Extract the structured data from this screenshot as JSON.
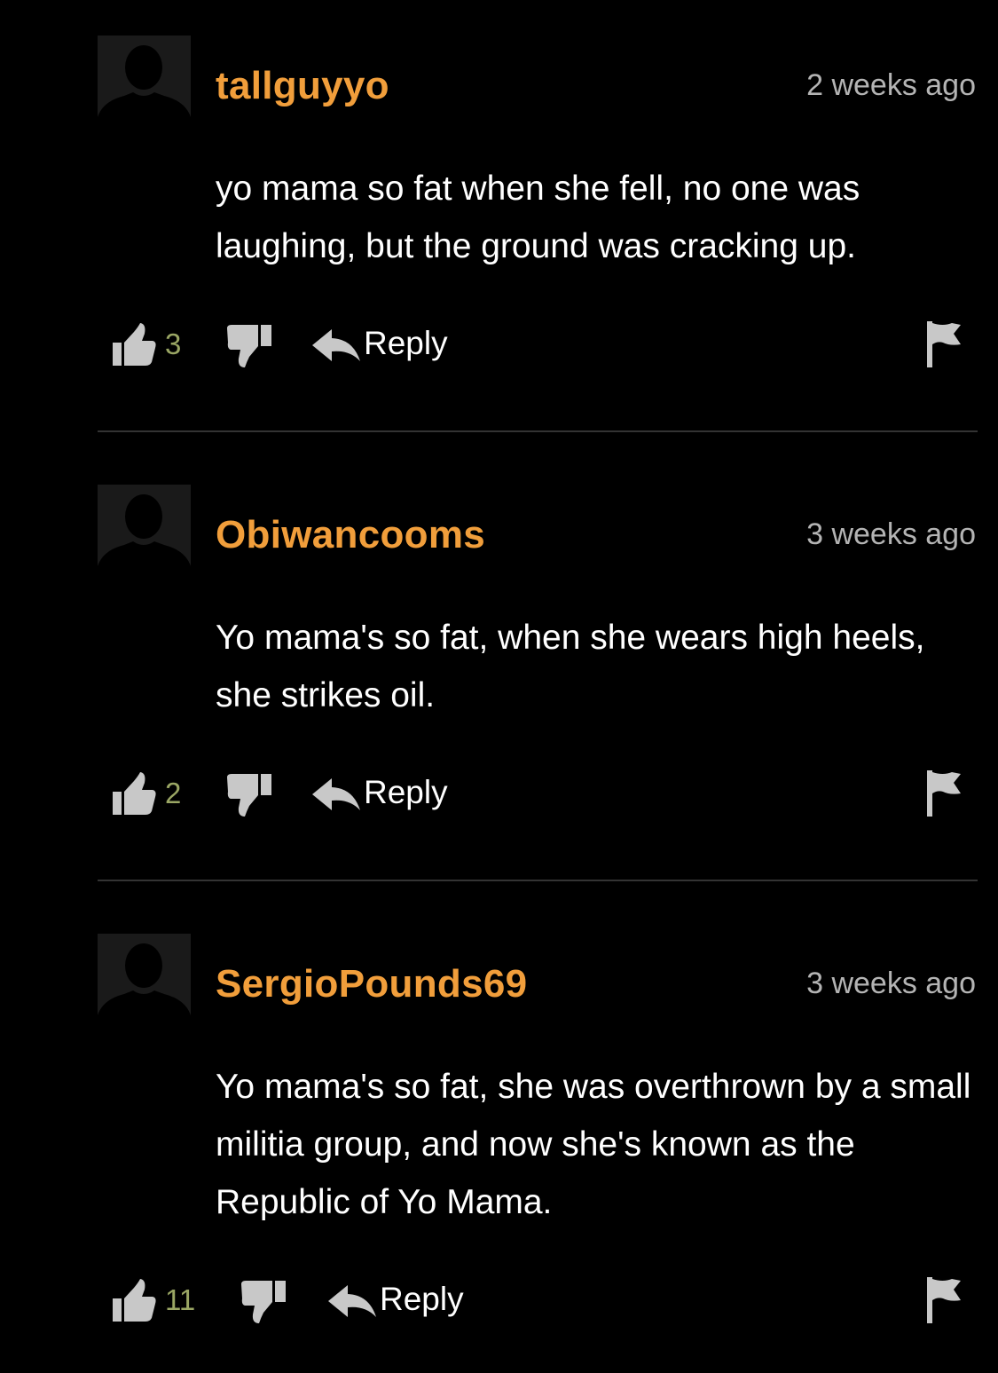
{
  "comments": [
    {
      "username": "tallguyyo",
      "timestamp": "2 weeks ago",
      "text": "yo mama so fat when she fell, no one was laughing, but the ground was cracking up.",
      "likes": "3",
      "reply_label": "Reply"
    },
    {
      "username": "Obiwancooms",
      "timestamp": "3 weeks ago",
      "text": "Yo mama's so fat, when she wears high heels, she strikes oil.",
      "likes": "2",
      "reply_label": "Reply"
    },
    {
      "username": "SergioPounds69",
      "timestamp": "3 weeks ago",
      "text": "Yo mama's so fat, she was overthrown by a small militia group, and now she's known as the Republic of Yo Mama.",
      "likes": "11",
      "reply_label": "Reply"
    }
  ],
  "colors": {
    "background": "#000000",
    "username": "#f19e3b",
    "timestamp": "#b4b4b4",
    "like_count": "#9aa664",
    "icon": "#c8c8c8",
    "divider": "#333333"
  },
  "icons": {
    "avatar": "default-avatar-icon",
    "like": "thumbs-up-icon",
    "dislike": "thumbs-down-icon",
    "reply": "reply-arrow-icon",
    "report": "flag-icon"
  }
}
